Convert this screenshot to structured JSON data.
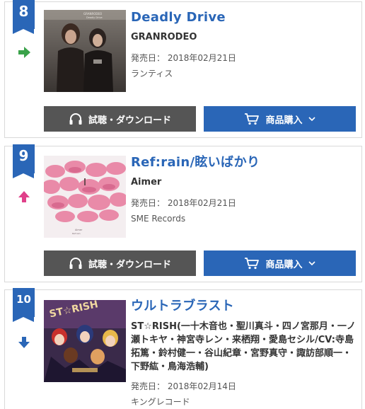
{
  "colors": {
    "accent": "#2a66b7",
    "listen_btn": "#555555",
    "trend_up": "#e0408a",
    "trend_same": "#3aa24a",
    "trend_down": "#2a66b7"
  },
  "release_prefix": "発売日：",
  "buttons": {
    "listen_label": "試聴・ダウンロード",
    "buy_label": "商品購入"
  },
  "items": [
    {
      "rank": "8",
      "trend": "same-arrow-icon",
      "title": "Deadly Drive",
      "artist": "GRANRODEO",
      "release_date": "2018年02月21日",
      "label": "ランティス"
    },
    {
      "rank": "9",
      "trend": "up-arrow-icon",
      "title": "Ref:rain/眩いばかり",
      "artist": "Aimer",
      "release_date": "2018年02月21日",
      "label": "SME Records"
    },
    {
      "rank": "10",
      "trend": "down-arrow-icon",
      "title": "ウルトラブラスト",
      "artist": "ST☆RISH(一十木音也・聖川真斗・四ノ宮那月・一ノ瀬トキヤ・神宮寺レン・来栖翔・愛島セシル/CV:寺島拓篤・鈴村健一・谷山紀章・宮野真守・諏訪部順一・下野紘・鳥海浩輔)",
      "release_date": "2018年02月14日",
      "label": "キングレコード"
    }
  ]
}
